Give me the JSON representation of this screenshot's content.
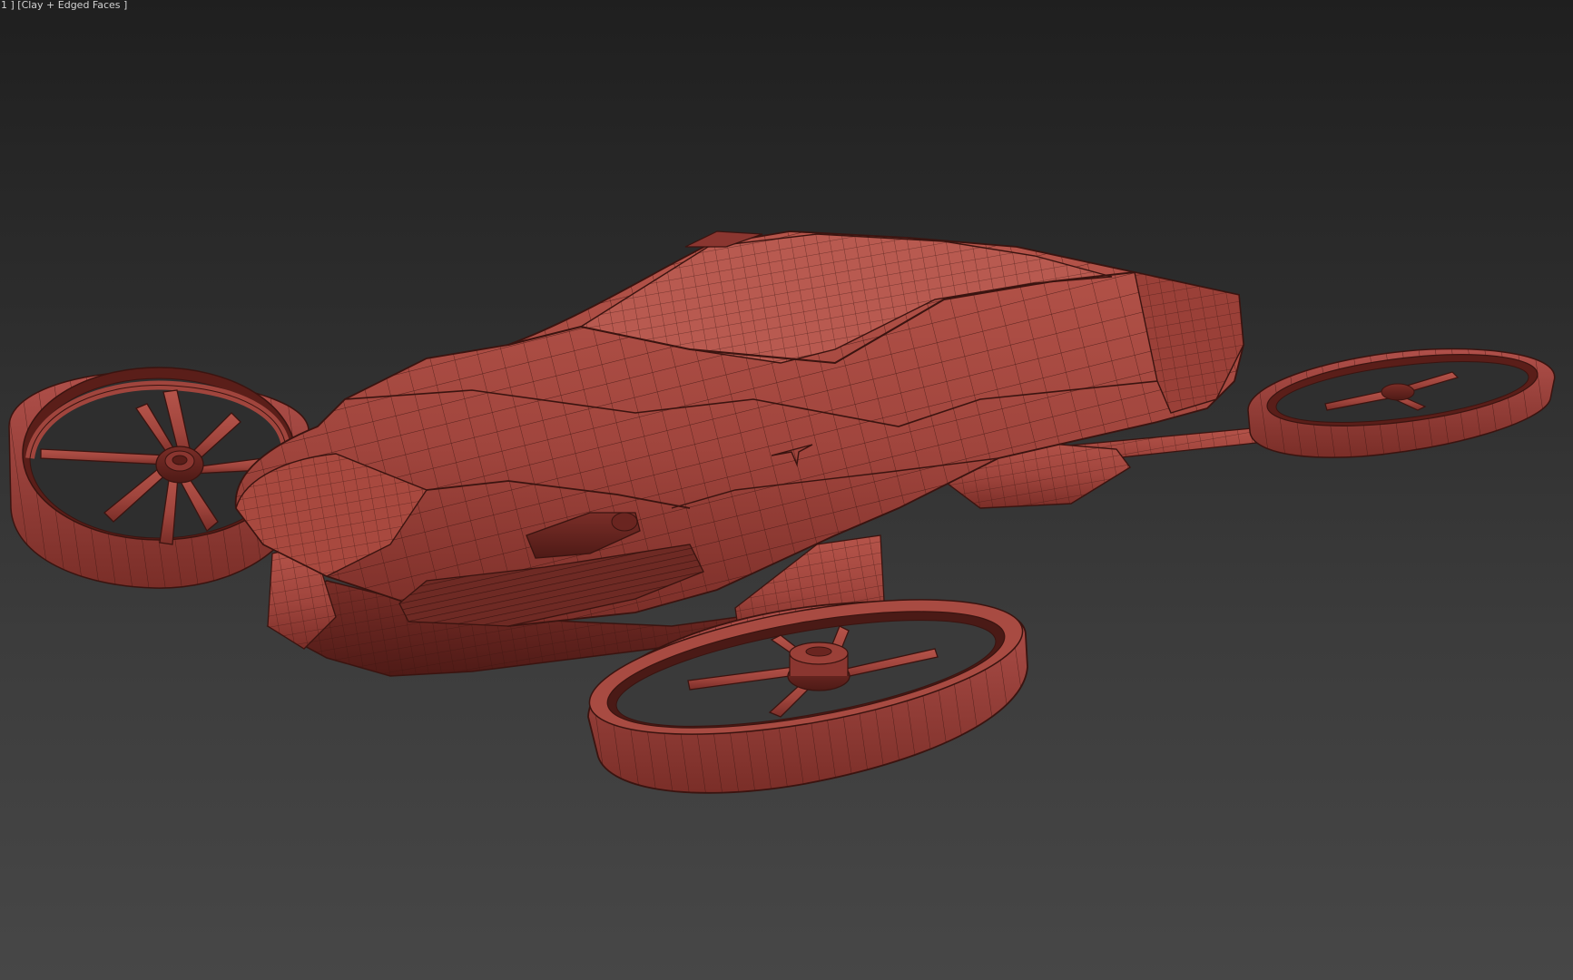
{
  "viewport": {
    "label": "1 ] [Clay + Edged Faces ]",
    "background_top": "#1f1f1f",
    "background_bottom": "#474747"
  },
  "model": {
    "clay_color": "#a0453d",
    "clay_light": "#b5544a",
    "clay_dark": "#6e2a24",
    "edge_color": "#3a1410"
  }
}
